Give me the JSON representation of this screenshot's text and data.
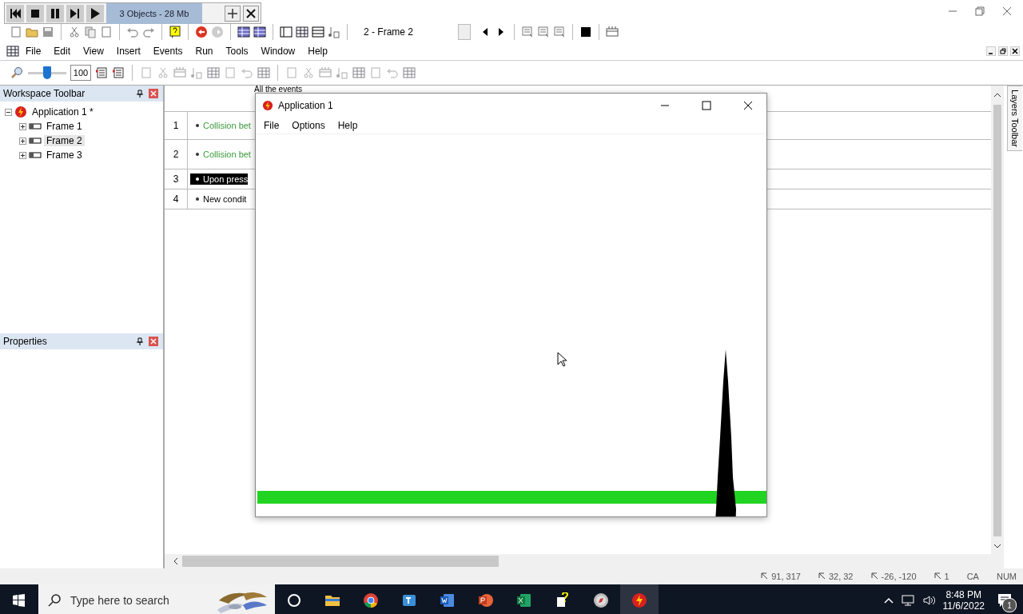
{
  "debug_toolbar": {
    "status": "3 Objects - 28 Mb"
  },
  "toolbar": {
    "frame_select": "2 - Frame 2"
  },
  "menu": [
    "File",
    "Edit",
    "View",
    "Insert",
    "Events",
    "Run",
    "Tools",
    "Window",
    "Help"
  ],
  "zoom": {
    "level": 0.5,
    "value": "100"
  },
  "workspace": {
    "title": "Workspace Toolbar",
    "tree": [
      {
        "label": "Application 1 *",
        "expanded": true,
        "selected": false,
        "children": [
          {
            "label": "Frame 1",
            "expanded": false,
            "selected": false
          },
          {
            "label": "Frame 2",
            "expanded": false,
            "selected": true
          },
          {
            "label": "Frame 3",
            "expanded": false,
            "selected": false
          }
        ]
      }
    ]
  },
  "properties": {
    "title": "Properties"
  },
  "event_editor": {
    "header": "All the events",
    "rows": [
      {
        "number": "1",
        "text": "Collision bet",
        "kind": "collision",
        "selected": false
      },
      {
        "number": "2",
        "text": "Collision bet",
        "kind": "collision",
        "selected": false
      },
      {
        "number": "3",
        "text": "Upon press",
        "kind": "plain",
        "selected": true
      },
      {
        "number": "4",
        "text": "New condit",
        "kind": "plain",
        "selected": false
      }
    ]
  },
  "layers_tab": "Layers Toolbar",
  "app_window": {
    "title": "Application 1",
    "menu": [
      "File",
      "Options",
      "Help"
    ]
  },
  "status_bar": {
    "position": "91, 317",
    "size": "32, 32",
    "offset": "-26, -120",
    "count": "1",
    "caps": "CA",
    "num": "NUM"
  },
  "taskbar": {
    "search_placeholder": "Type here to search",
    "time": "8:48 PM",
    "date": "11/6/2022",
    "notifications": "1"
  }
}
